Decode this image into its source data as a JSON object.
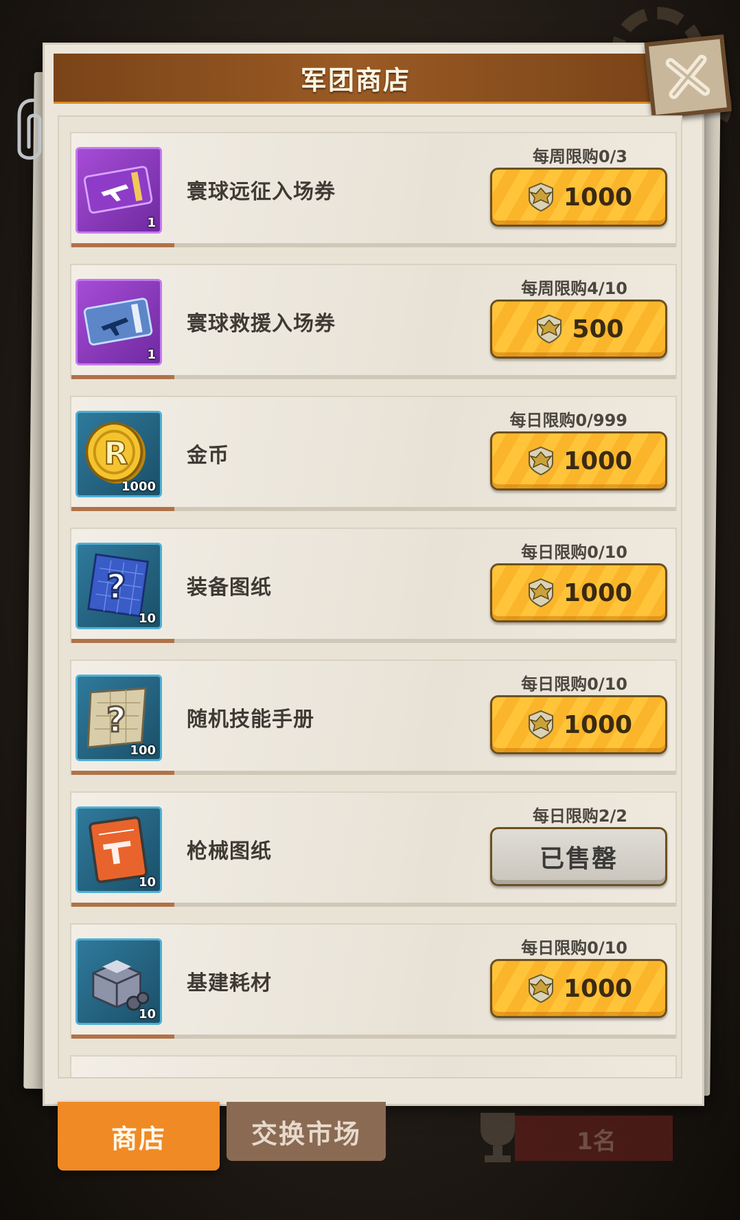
{
  "title": "军团商店",
  "items": [
    {
      "name": "寰球远征入场券",
      "limit": "每周限购0/3",
      "price": "1000",
      "qty": "1",
      "icon": "purple-ticket-icon",
      "sold": false
    },
    {
      "name": "寰球救援入场券",
      "limit": "每周限购4/10",
      "price": "500",
      "qty": "1",
      "icon": "blue-ticket-icon",
      "sold": false
    },
    {
      "name": "金币",
      "limit": "每日限购0/999",
      "price": "1000",
      "qty": "1000",
      "icon": "gold-coin-icon",
      "sold": false
    },
    {
      "name": "装备图纸",
      "limit": "每日限购0/10",
      "price": "1000",
      "qty": "10",
      "icon": "equipment-blueprint-icon",
      "sold": false
    },
    {
      "name": "随机技能手册",
      "limit": "每日限购0/10",
      "price": "1000",
      "qty": "100",
      "icon": "skill-manual-icon",
      "sold": false
    },
    {
      "name": "枪械图纸",
      "limit": "每日限购2/2",
      "price": "已售罄",
      "qty": "10",
      "icon": "gun-blueprint-icon",
      "sold": true
    },
    {
      "name": "基建耗材",
      "limit": "每日限购0/10",
      "price": "1000",
      "qty": "10",
      "icon": "construction-material-icon",
      "sold": false
    }
  ],
  "tabs": {
    "shop": "商店",
    "exchange": "交换市场"
  },
  "rank": {
    "label": "1名"
  },
  "colors": {
    "accent": "#f08a24",
    "buy_button": "#ffc43a",
    "title_bar": "#8a4e1e"
  }
}
